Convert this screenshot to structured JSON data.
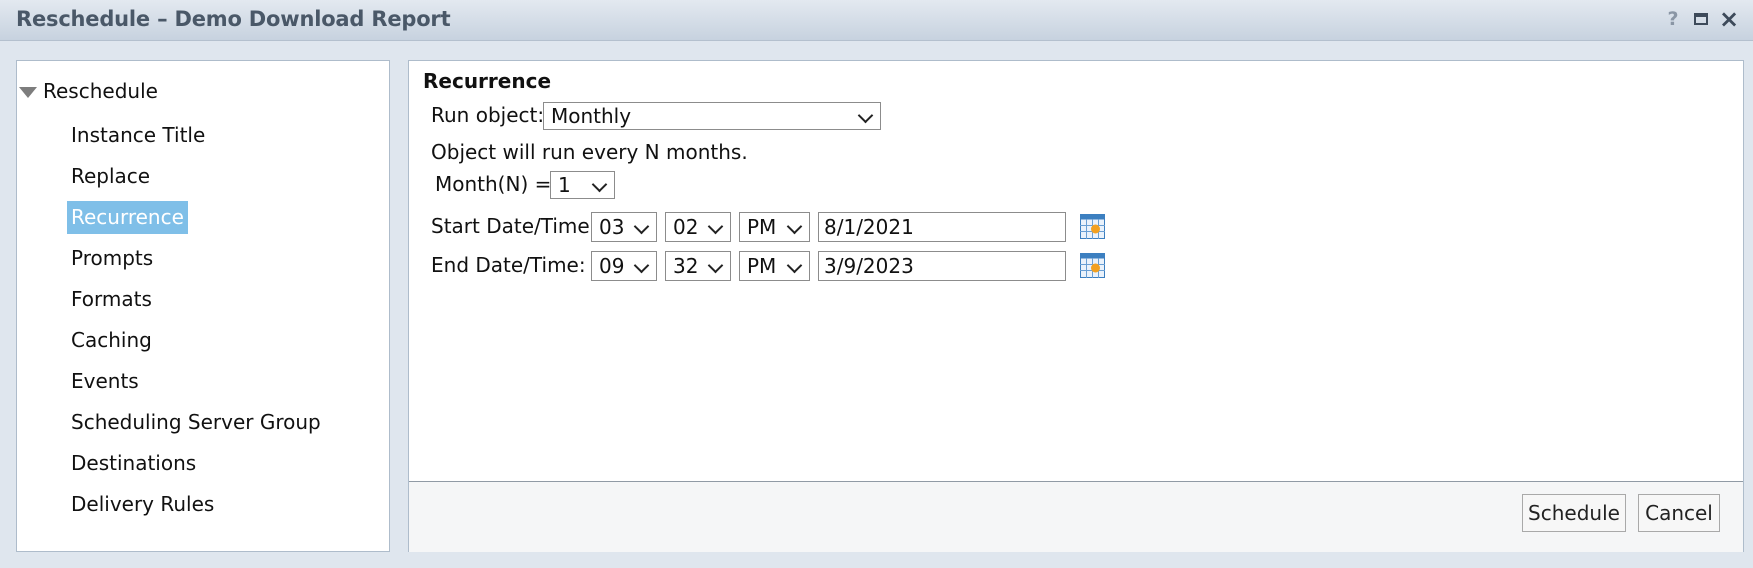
{
  "window": {
    "title": "Reschedule – Demo Download Report",
    "help_icon": "?",
    "maximize_icon": "maximize-icon",
    "close_icon": "×"
  },
  "nav": {
    "root": "Reschedule",
    "items": [
      {
        "label": "Instance Title",
        "selected": false
      },
      {
        "label": "Replace",
        "selected": false
      },
      {
        "label": "Recurrence",
        "selected": true
      },
      {
        "label": "Prompts",
        "selected": false
      },
      {
        "label": "Formats",
        "selected": false
      },
      {
        "label": "Caching",
        "selected": false
      },
      {
        "label": "Events",
        "selected": false
      },
      {
        "label": "Scheduling Server Group",
        "selected": false
      },
      {
        "label": "Destinations",
        "selected": false
      },
      {
        "label": "Delivery Rules",
        "selected": false
      }
    ]
  },
  "recurrence": {
    "title": "Recurrence",
    "run_object_label": "Run object:",
    "run_object_value": "Monthly",
    "description": "Object will run every N months.",
    "month_n_label": "Month(N) =",
    "month_n_value": "1",
    "start": {
      "label": "Start Date/Time:",
      "hour": "03",
      "minute": "02",
      "ampm": "PM",
      "date": "8/1/2021"
    },
    "end": {
      "label": "End Date/Time:",
      "hour": "09",
      "minute": "32",
      "ampm": "PM",
      "date": "3/9/2023"
    }
  },
  "buttons": {
    "schedule": "Schedule",
    "cancel": "Cancel"
  },
  "colors": {
    "selection": "#7fbfe8",
    "title_text": "#4a5868",
    "calendar_orange": "#f2a020",
    "calendar_blue": "#3c7fc0"
  }
}
